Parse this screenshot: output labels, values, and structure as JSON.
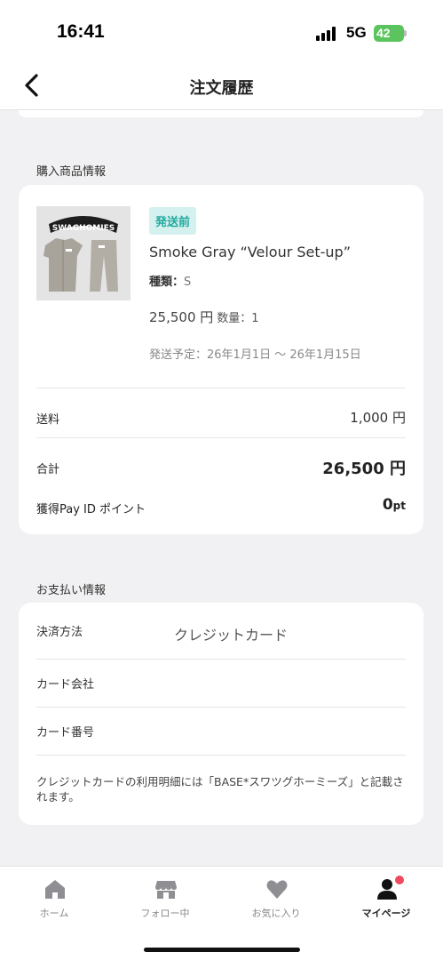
{
  "status_bar": {
    "time": "16:41",
    "network": "5G",
    "battery": "42"
  },
  "nav": {
    "title": "注文履歴"
  },
  "purchase": {
    "section_title": "購入商品情報",
    "product": {
      "status_badge": "発送前",
      "name": "Smoke Gray “Velour Set-up”",
      "variant_label": "種類：",
      "variant_value": "S",
      "price": "25,500 円",
      "quantity": "数量：1",
      "ship_date": "発送予定：26年1月1日 〜 26年1月15日",
      "image_logo_text": "SWAGHOMIES"
    },
    "shipping_label": "送料",
    "shipping_value": "1,000 円",
    "total_label": "合計",
    "total_value": "26,500 円",
    "points_label": "獲得Pay ID ポイント",
    "points_value": "0",
    "points_unit": "pt"
  },
  "payment": {
    "section_title": "お支払い情報",
    "method_label": "決済方法",
    "method_value": "クレジットカード",
    "company_label": "カード会社",
    "number_label": "カード番号",
    "note": "クレジットカードの利用明細には「BASE*スワツグホーミーズ」と記載されます。"
  },
  "tabs": [
    {
      "label": "ホーム",
      "icon": "home-icon"
    },
    {
      "label": "フォロー中",
      "icon": "shop-icon"
    },
    {
      "label": "お気に入り",
      "icon": "heart-icon"
    },
    {
      "label": "マイページ",
      "icon": "person-icon"
    }
  ],
  "colors": {
    "accent": "#20a99f",
    "badge_bg": "#d5f1ef",
    "notify": "#ef4a5e",
    "background": "#f1f1f3"
  }
}
